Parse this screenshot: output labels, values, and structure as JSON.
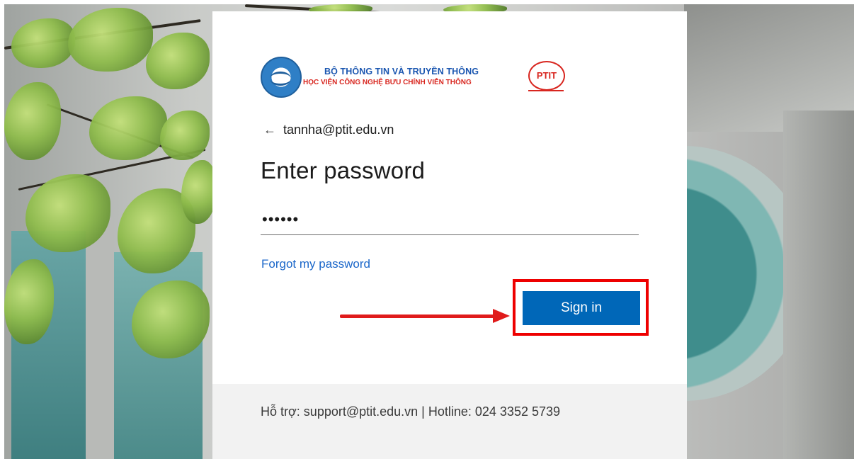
{
  "logo": {
    "line1": "BỘ THÔNG TIN VÀ TRUYỀN THÔNG",
    "line2": "HỌC VIỆN CÔNG NGHỆ BƯU CHÍNH VIỄN THÔNG",
    "badge": "PTIT"
  },
  "identity": {
    "back_icon": "←",
    "email": "tannha@ptit.edu.vn"
  },
  "form": {
    "title": "Enter password",
    "password_value": "••••••",
    "forgot_label": "Forgot my password",
    "signin_label": "Sign in"
  },
  "footer": {
    "support_text": "Hỗ trợ: support@ptit.edu.vn | Hotline: 024 3352 5739"
  },
  "colors": {
    "accent": "#0067b8",
    "link": "#1a66c9",
    "annotation": "#ee0000"
  }
}
